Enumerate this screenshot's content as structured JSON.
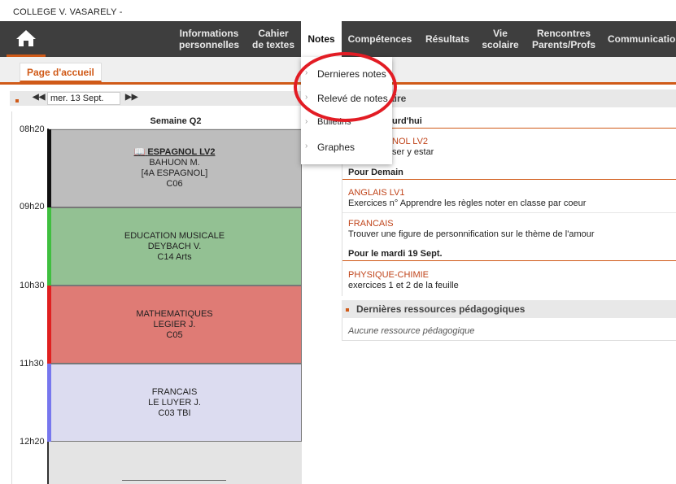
{
  "school": "COLLEGE V. VASARELY -",
  "nav": {
    "items": [
      {
        "label": "Informations\npersonnelles"
      },
      {
        "label": "Cahier\nde textes"
      },
      {
        "label": "Notes"
      },
      {
        "label": "Compétences"
      },
      {
        "label": "Résultats"
      },
      {
        "label": "Vie\nscolaire"
      },
      {
        "label": "Rencontres\nParents/Profs"
      },
      {
        "label": "Communication"
      }
    ]
  },
  "tab": "Page d'accueil",
  "date": "mer. 13 Sept.",
  "week": "Semaine Q2",
  "times": [
    "08h20",
    "09h20",
    "10h30",
    "11h30",
    "12h20"
  ],
  "courses": [
    {
      "lines": [
        "ESPAGNOL LV2",
        "BAHUON M.",
        "[4A ESPAGNOL]",
        "C06"
      ],
      "color": "#bdbdbd",
      "bar": "#111111"
    },
    {
      "lines": [
        "EDUCATION MUSICALE",
        "DEYBACH V.",
        "C14 Arts"
      ],
      "color": "#93c193",
      "bar": "#3fbf3f"
    },
    {
      "lines": [
        "MATHEMATIQUES",
        "LEGIER J.",
        "C05"
      ],
      "color": "#df7b75",
      "bar": "#e02020"
    },
    {
      "lines": [
        "FRANCAIS",
        "LE LUYER J.",
        "C03 TBI"
      ],
      "color": "#dcdcf0",
      "bar": "#7777ee"
    }
  ],
  "menu": {
    "items": [
      "Dernieres notes",
      "Relevé de notes",
      "Bulletins",
      "Graphes"
    ]
  },
  "cahier": {
    "title": "Cahier de textes – travail à faire",
    "title_visible": "aire",
    "today_visible": "urd'hui",
    "today_item": {
      "matiere": "NOL LV2",
      "desc": "ser y estar"
    },
    "demain": "Pour Demain",
    "demain_items": [
      {
        "matiere": "ANGLAIS LV1",
        "desc": "Exercices n° Apprendre les règles noter en classe par coeur"
      },
      {
        "matiere": "FRANCAIS",
        "desc": "Trouver une figure de personnification sur le thème de l'amour"
      }
    ],
    "mardi": "Pour le mardi 19 Sept.",
    "mardi_items": [
      {
        "matiere": "PHYSIQUE-CHIMIE",
        "desc": "exercices 1 et 2 de la feuille"
      }
    ]
  },
  "ressources": {
    "title": "Dernières ressources pédagogiques",
    "empty": "Aucune ressource pédagogique"
  },
  "colors": {
    "accent": "#d05a18",
    "highlight": "#e21c24"
  }
}
